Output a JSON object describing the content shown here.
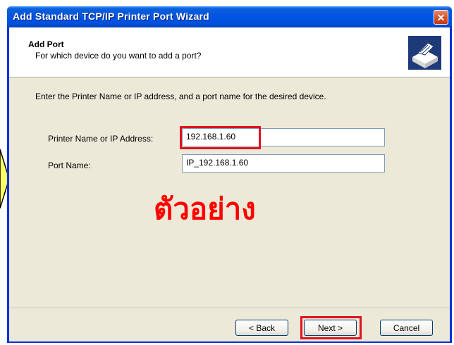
{
  "window": {
    "title": "Add Standard TCP/IP Printer Port Wizard",
    "close_symbol": "✕"
  },
  "header": {
    "title": "Add Port",
    "subtitle": "For which device do you want to add a port?",
    "icon": "printer-network-icon"
  },
  "body": {
    "instruction": "Enter the Printer Name or IP address, and a port name for the desired device.",
    "printer_label": "Printer Name or IP Address:",
    "printer_value": "192.168.1.60",
    "port_label": "Port Name:",
    "port_value": "IP_192.168.1.60",
    "watermark": "ตัวอย่าง"
  },
  "buttons": {
    "back": "< Back",
    "next": "Next >",
    "cancel": "Cancel"
  },
  "colors": {
    "highlight": "#e0121f",
    "watermark": "#ff0000",
    "arrow_fill": "#ffff66"
  }
}
